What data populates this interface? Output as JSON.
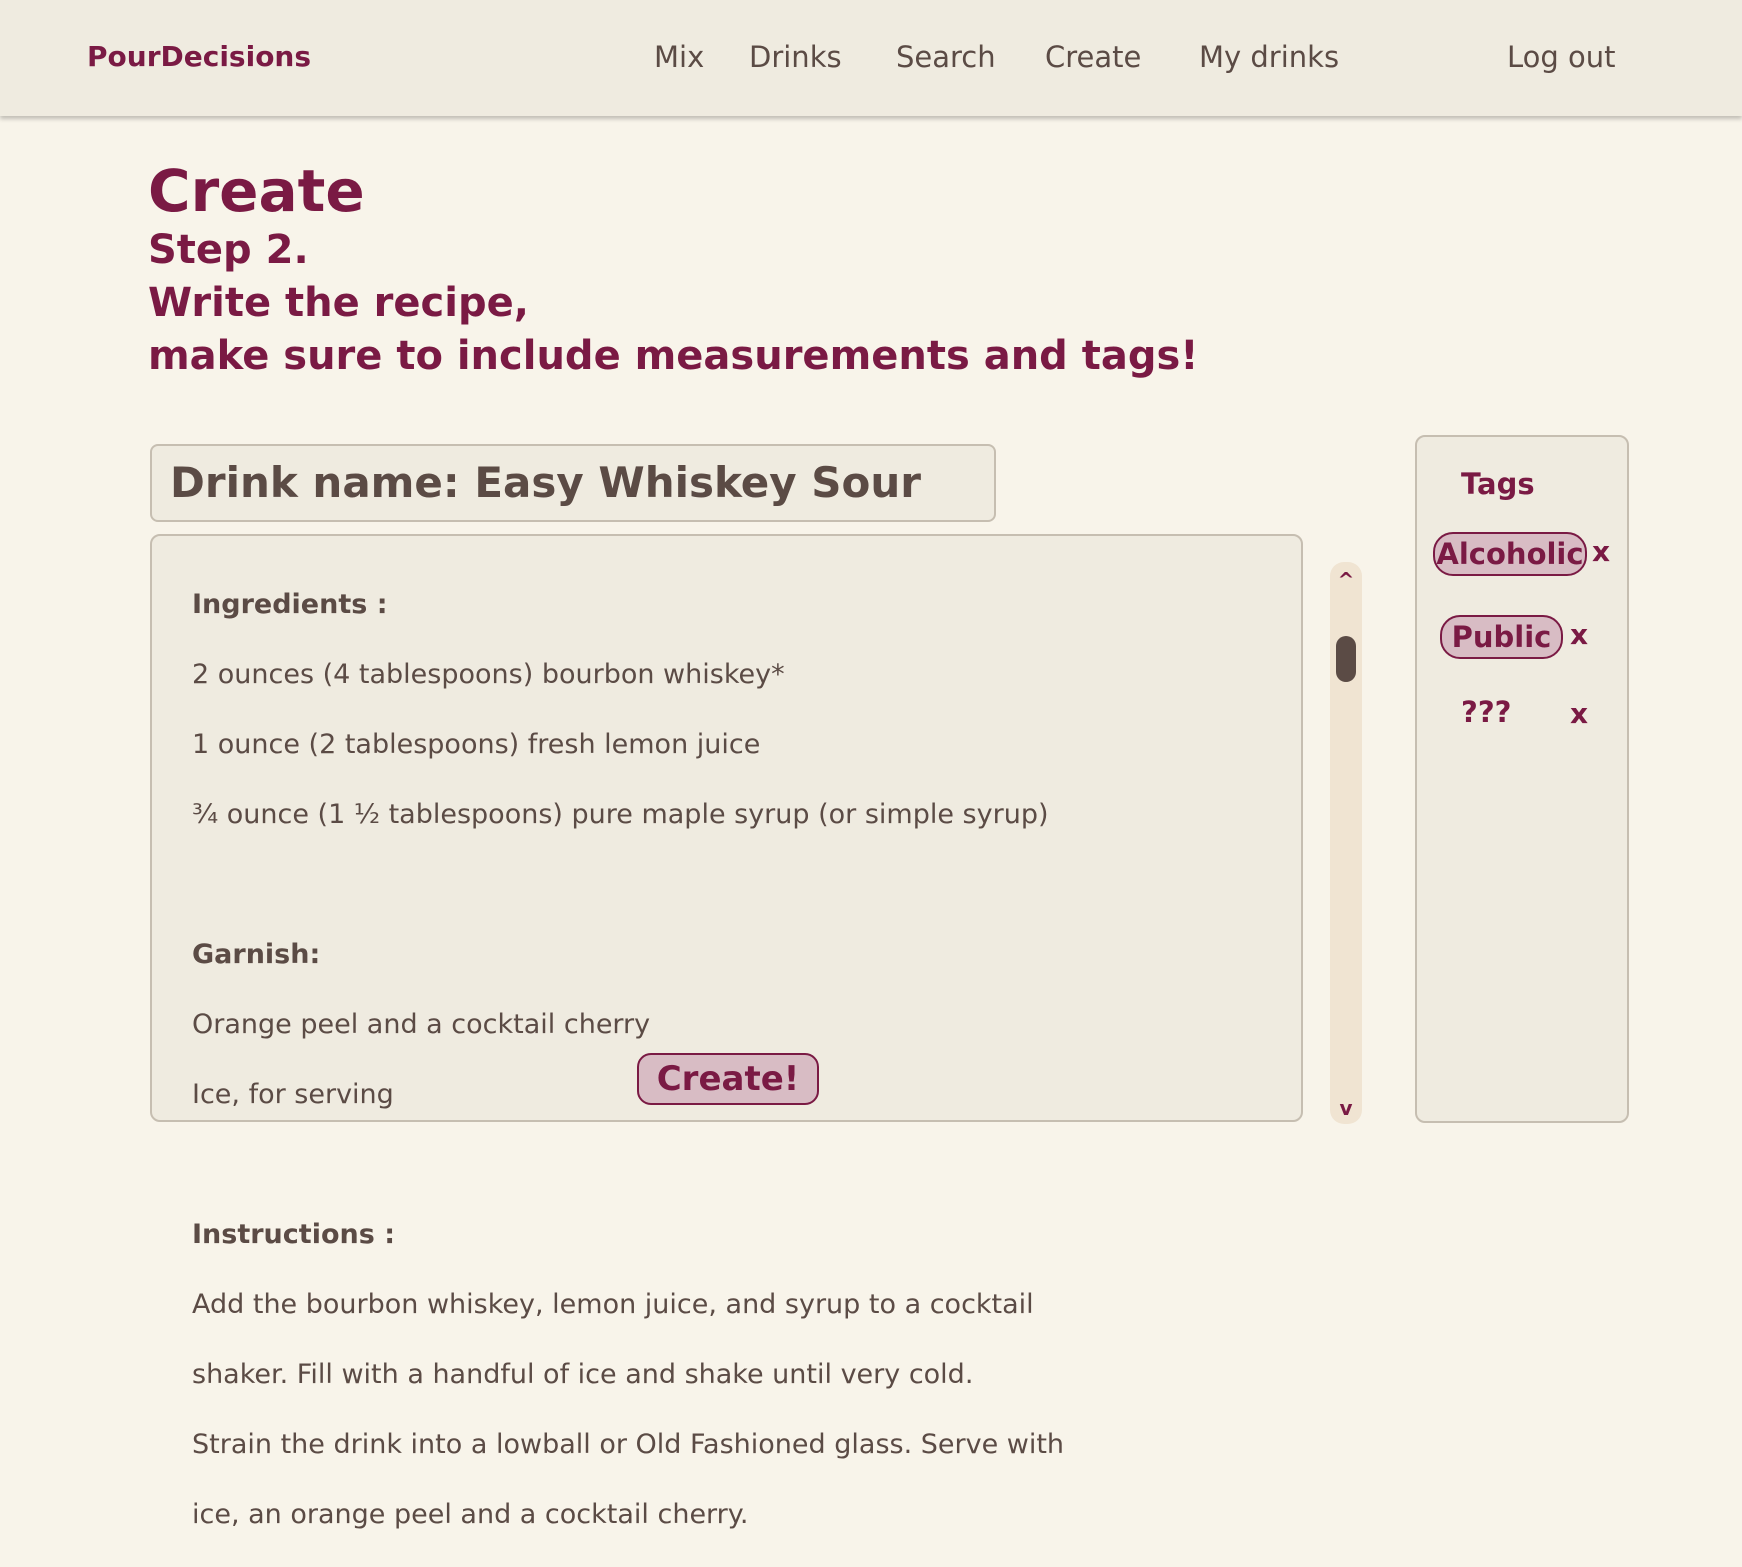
{
  "navbar": {
    "brand": "PourDecisions",
    "links": [
      "Mix",
      "Drinks",
      "Search",
      "Create",
      "My drinks"
    ],
    "logout": "Log out"
  },
  "page": {
    "title": "Create",
    "subtitle_lines": [
      "Step 2.",
      "Write the recipe,",
      "make sure to include measurements and tags!"
    ]
  },
  "recipe": {
    "drink_name": "Drink name: Easy Whiskey Sour",
    "ingredients_heading": "Ingredients :",
    "ingredients": [
      "2 ounces (4 tablespoons) bourbon whiskey*",
      "1 ounce (2 tablespoons) fresh lemon juice",
      "¾ ounce (1 ½ tablespoons) pure maple syrup (or simple syrup)"
    ],
    "garnish_heading": "Garnish:",
    "garnish": [
      "Orange peel and a cocktail cherry",
      "Ice, for serving"
    ],
    "instructions_heading": "Instructions :",
    "instructions": [
      "Add the bourbon whiskey, lemon juice, and syrup to a cocktail",
      "shaker. Fill with a handful of ice and shake until very cold.",
      "Strain the drink into a lowball or Old Fashioned glass. Serve with",
      "ice, an orange peel and a cocktail cherry."
    ],
    "create_label": "Create!"
  },
  "scrollbar": {
    "up_glyph": "^",
    "down_glyph": "v"
  },
  "tags": {
    "title": "Tags",
    "items": [
      "Alcoholic",
      "Public",
      "???"
    ],
    "remove_glyph": "x"
  },
  "colors": {
    "accent": "#7a1a44",
    "text": "#5b4b45",
    "background": "#f8f4ea",
    "panel": "#efebe0",
    "pill": "#d8bcc4"
  }
}
